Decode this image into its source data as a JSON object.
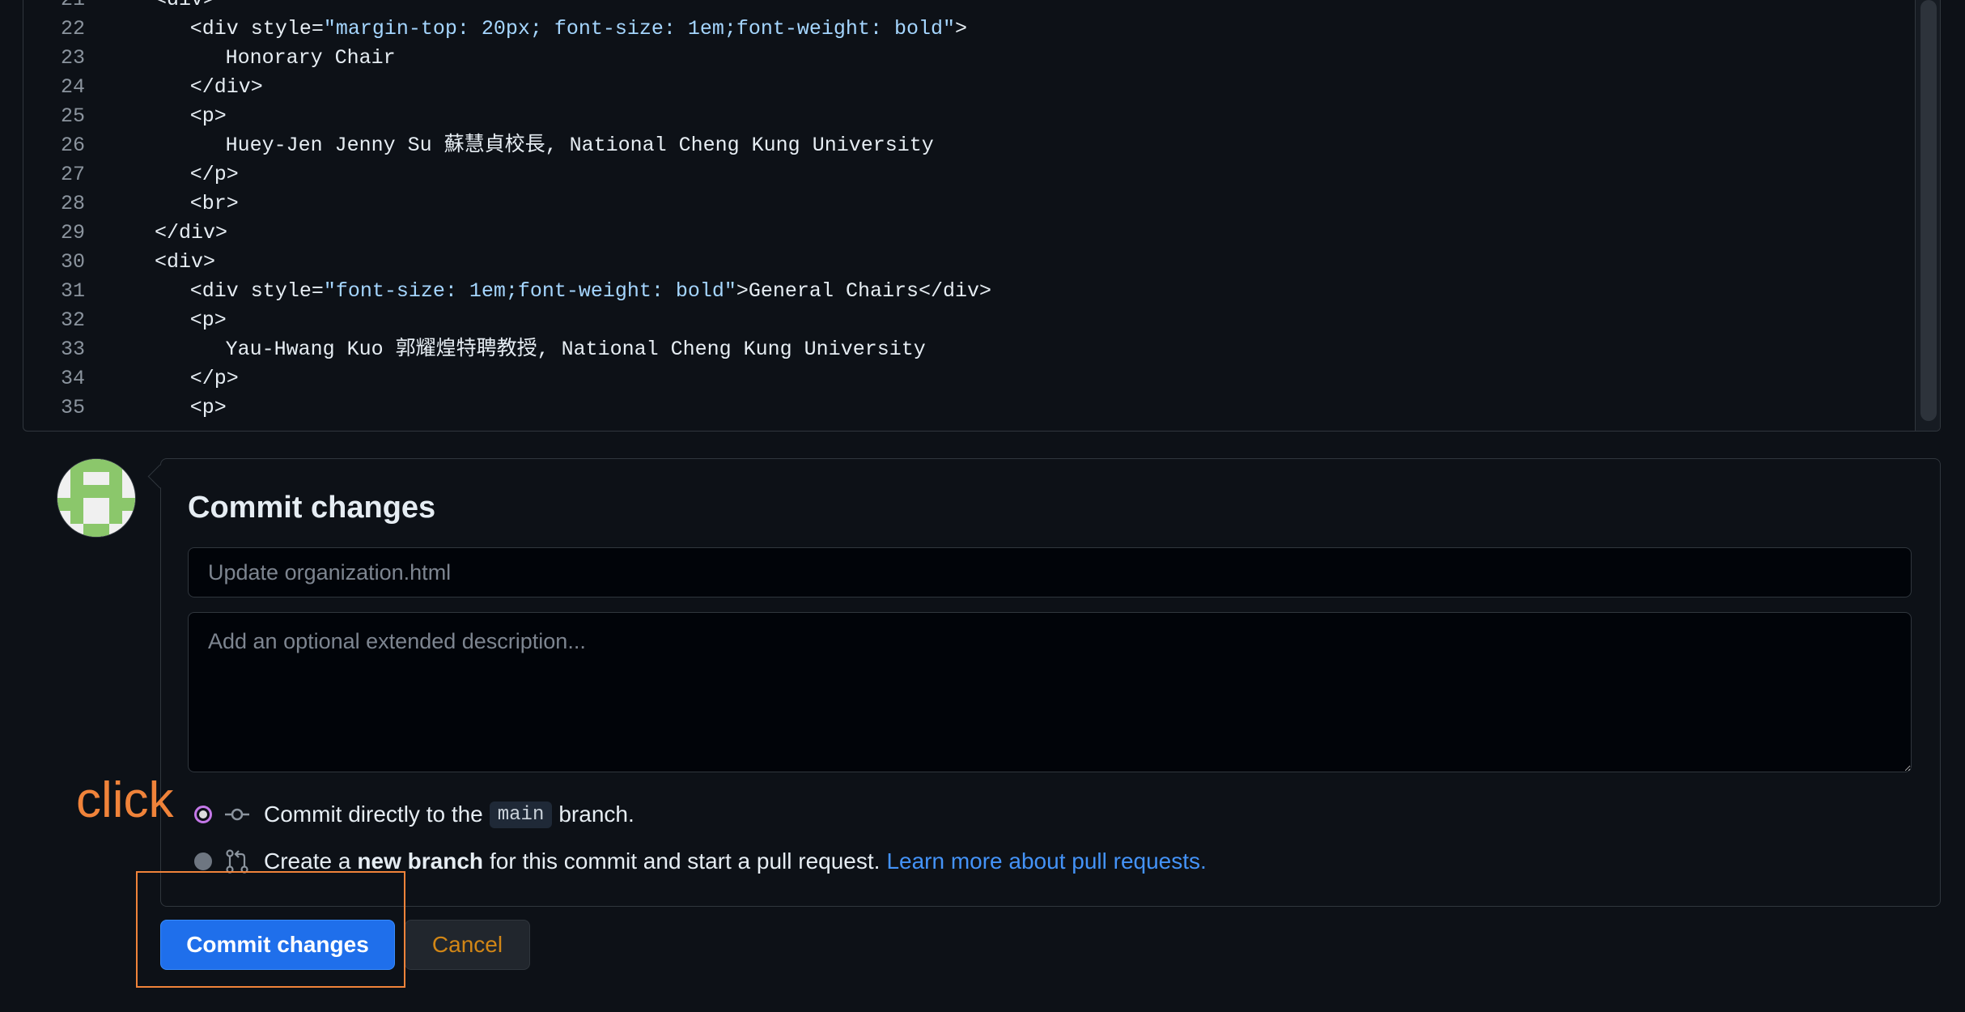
{
  "editor": {
    "lines": [
      {
        "n": "21",
        "indent": 11,
        "text": "<div>"
      },
      {
        "n": "22",
        "indent": 14,
        "pre": "<div style=",
        "val": "\"margin-top: 20px; font-size: 1em;font-weight: bold\"",
        "post": ">"
      },
      {
        "n": "23",
        "indent": 17,
        "text": "Honorary Chair"
      },
      {
        "n": "24",
        "indent": 14,
        "text": "</div>"
      },
      {
        "n": "25",
        "indent": 14,
        "text": "<p>"
      },
      {
        "n": "26",
        "indent": 17,
        "text": "Huey-Jen Jenny Su 蘇慧貞校長, National Cheng Kung University"
      },
      {
        "n": "27",
        "indent": 14,
        "text": "</p>"
      },
      {
        "n": "28",
        "indent": 14,
        "text": "<br>"
      },
      {
        "n": "29",
        "indent": 11,
        "text": "</div>"
      },
      {
        "n": "30",
        "indent": 11,
        "text": "<div>"
      },
      {
        "n": "31",
        "indent": 14,
        "pre": "<div style=",
        "val": "\"font-size: 1em;font-weight: bold\"",
        "post": ">General Chairs</div>"
      },
      {
        "n": "32",
        "indent": 14,
        "text": "<p>"
      },
      {
        "n": "33",
        "indent": 17,
        "text": "Yau-Hwang Kuo 郭耀煌特聘教授, National Cheng Kung University"
      },
      {
        "n": "34",
        "indent": 14,
        "text": "</p>"
      },
      {
        "n": "35",
        "indent": 14,
        "text": "<p>"
      }
    ]
  },
  "commit": {
    "title": "Commit changes",
    "summary_placeholder": "Update organization.html",
    "description_placeholder": "Add an optional extended description...",
    "option_direct": {
      "prefix": "Commit directly to the",
      "branch": "main",
      "suffix": "branch."
    },
    "option_new": {
      "prefix": "Create a",
      "bold": "new branch",
      "suffix": "for this commit and start a pull request.",
      "link": "Learn more about pull requests."
    },
    "commit_button": "Commit changes",
    "cancel_button": "Cancel"
  },
  "annotation": {
    "label": "click"
  },
  "colors": {
    "background": "#0d1117",
    "primary_button": "#1f6feb",
    "annotation": "#f0833a",
    "link": "#4493f8"
  },
  "icons": {
    "commit": "git-commit-icon",
    "pull_request": "git-pull-request-icon"
  }
}
